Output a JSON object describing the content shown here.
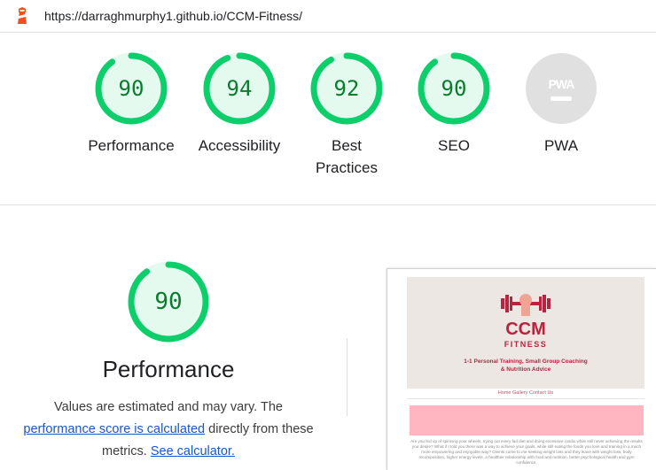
{
  "url": "https://darraghmurphy1.github.io/CCM-Fitness/",
  "colors": {
    "pass": "#0cce6b",
    "pass_bg": "#e5faef",
    "pass_text": "#0a7c2d",
    "na": "#e0e0e0",
    "brand": "#b8243f",
    "link": "#1a56c9"
  },
  "gauges": [
    {
      "label": "Performance",
      "score": "90",
      "fraction": 0.9
    },
    {
      "label": "Accessibility",
      "score": "94",
      "fraction": 0.94
    },
    {
      "label": "Best Practices",
      "score": "92",
      "fraction": 0.92
    },
    {
      "label": "SEO",
      "score": "90",
      "fraction": 0.9
    },
    {
      "label": "PWA",
      "badge": "PWA",
      "icon": "pwa-dash-icon"
    }
  ],
  "performance": {
    "score": "90",
    "fraction": 0.9,
    "title": "Performance",
    "desc_1": "Values are estimated and may vary. The",
    "link_1": "performance score is calculated",
    "desc_2": " directly from these",
    "desc_3": "metrics. ",
    "link_2": "See calculator."
  },
  "screenshot": {
    "brand": "CCM",
    "brand_sub": "FITNESS",
    "tagline_1": "1-1 Personal Training, Small Group Coaching",
    "tagline_2": "& Nutrition Advice",
    "nav": "Home  Gallery  Contact Us",
    "body": "Are you fed up of spinning your wheels, trying out every fad diet and doing excessive cardio while still never achieving the results you desire? What if I told you there was a way to achieve your goals, while still eating the foods you love and training in a much more empowering and enjoyable way? Clients come to me seeking weight loss and they leave with weight loss, body recomposition, higher energy levels, a healthier relationship with food and nutrition, better psychological health and gym confidence."
  }
}
